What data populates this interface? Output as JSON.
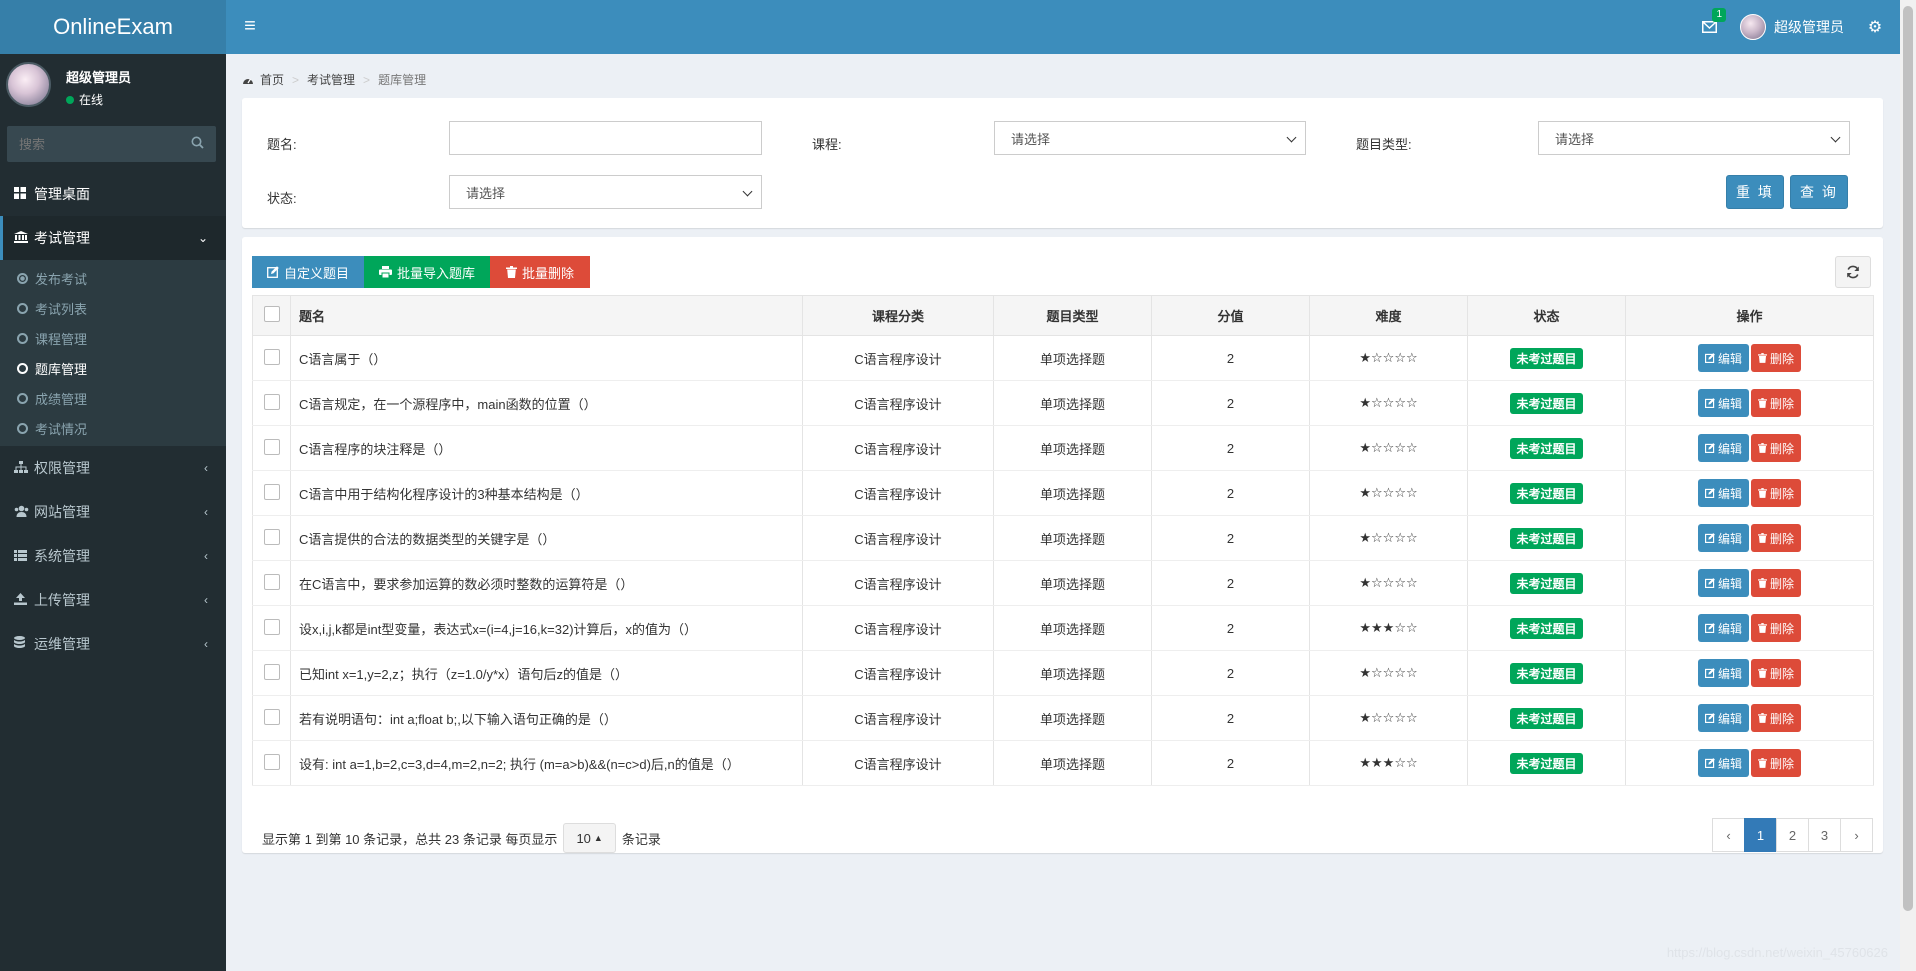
{
  "header": {
    "logo": "OnlineExam",
    "mail_badge": "1",
    "user_name": "超级管理员"
  },
  "sidebar": {
    "user": {
      "name": "超级管理员",
      "status": "在线"
    },
    "search_placeholder": "搜索",
    "items": [
      {
        "label": "管理桌面",
        "icon": "dashboard-icon"
      },
      {
        "label": "考试管理",
        "icon": "bank-icon",
        "open": true
      },
      {
        "label": "权限管理",
        "icon": "sitemap-icon"
      },
      {
        "label": "网站管理",
        "icon": "users-icon"
      },
      {
        "label": "系统管理",
        "icon": "list-icon"
      },
      {
        "label": "上传管理",
        "icon": "upload-icon"
      },
      {
        "label": "运维管理",
        "icon": "database-icon"
      }
    ],
    "submenu": [
      "发布考试",
      "考试列表",
      "课程管理",
      "题库管理",
      "成绩管理",
      "考试情况"
    ]
  },
  "breadcrumb": [
    "首页",
    "考试管理",
    "题库管理"
  ],
  "filter": {
    "name_label": "题名:",
    "course_label": "课程:",
    "type_label": "题目类型:",
    "status_label": "状态:",
    "select_default": "请选择",
    "reset_label": "重 填",
    "query_label": "查 询"
  },
  "toolbar": {
    "custom_label": "自定义题目",
    "import_label": "批量导入题库",
    "delete_label": "批量删除"
  },
  "table": {
    "headers": [
      "题名",
      "课程分类",
      "题目类型",
      "分值",
      "难度",
      "状态",
      "操作"
    ],
    "edit_label": "编辑",
    "delete_label": "删除",
    "rows": [
      {
        "name": "C语言属于（）",
        "course": "C语言程序设计",
        "type": "单项选择题",
        "score": "2",
        "difficulty": "★☆☆☆☆",
        "status": "未考过题目"
      },
      {
        "name": "C语言规定，在一个源程序中，main函数的位置（）",
        "course": "C语言程序设计",
        "type": "单项选择题",
        "score": "2",
        "difficulty": "★☆☆☆☆",
        "status": "未考过题目"
      },
      {
        "name": "C语言程序的块注释是（）",
        "course": "C语言程序设计",
        "type": "单项选择题",
        "score": "2",
        "difficulty": "★☆☆☆☆",
        "status": "未考过题目"
      },
      {
        "name": "C语言中用于结构化程序设计的3种基本结构是（）",
        "course": "C语言程序设计",
        "type": "单项选择题",
        "score": "2",
        "difficulty": "★☆☆☆☆",
        "status": "未考过题目"
      },
      {
        "name": "C语言提供的合法的数据类型的关键字是（）",
        "course": "C语言程序设计",
        "type": "单项选择题",
        "score": "2",
        "difficulty": "★☆☆☆☆",
        "status": "未考过题目"
      },
      {
        "name": "在C语言中，要求参加运算的数必须时整数的运算符是（）",
        "course": "C语言程序设计",
        "type": "单项选择题",
        "score": "2",
        "difficulty": "★☆☆☆☆",
        "status": "未考过题目"
      },
      {
        "name": "设x,i,j,k都是int型变量，表达式x=(i=4,j=16,k=32)计算后，x的值为（）",
        "course": "C语言程序设计",
        "type": "单项选择题",
        "score": "2",
        "difficulty": "★★★☆☆",
        "status": "未考过题目"
      },
      {
        "name": "已知int x=1,y=2,z；执行（z=1.0/y*x）语句后z的值是（）",
        "course": "C语言程序设计",
        "type": "单项选择题",
        "score": "2",
        "difficulty": "★☆☆☆☆",
        "status": "未考过题目"
      },
      {
        "name": "若有说明语句：int a;float b;,以下输入语句正确的是（）",
        "course": "C语言程序设计",
        "type": "单项选择题",
        "score": "2",
        "difficulty": "★☆☆☆☆",
        "status": "未考过题目"
      },
      {
        "name": "设有: int a=1,b=2,c=3,d=4,m=2,n=2; 执行 (m=a>b)&&(n=c>d)后,n的值是（）",
        "course": "C语言程序设计",
        "type": "单项选择题",
        "score": "2",
        "difficulty": "★★★☆☆",
        "status": "未考过题目"
      }
    ]
  },
  "pagination": {
    "info_prefix": "显示第 1 到第 10 条记录，总共 23 条记录 每页显示",
    "page_size": "10",
    "info_suffix": "条记录",
    "prev": "‹",
    "pages": [
      "1",
      "2",
      "3"
    ],
    "next": "›"
  },
  "watermark": "https://blog.csdn.net/weixin_45760626"
}
